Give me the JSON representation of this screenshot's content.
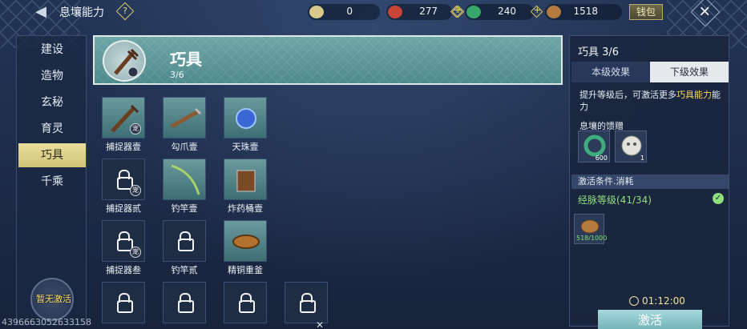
{
  "header_bar": {
    "title": "息壤能力",
    "help": "?",
    "resources": [
      {
        "icon": "gourd-icon",
        "value": "0",
        "color": "#d9c98a"
      },
      {
        "icon": "red-spiral-icon",
        "value": "277",
        "color": "#c84436"
      },
      {
        "icon": "green-coin-icon",
        "value": "240",
        "color": "#38a86a"
      },
      {
        "icon": "bean-icon",
        "value": "1518",
        "color": "#b47a3e"
      }
    ],
    "wallet_label": "钱包",
    "close_label": "✕"
  },
  "nav": {
    "items": [
      "建设",
      "造物",
      "玄秘",
      "育灵",
      "巧具",
      "千乘"
    ],
    "active_index": 4,
    "no_activate_label": "暂无激活"
  },
  "main": {
    "header": {
      "title": "巧具",
      "progress": "3/6"
    },
    "items": [
      {
        "label": "捕捉器壹",
        "unlocked": true,
        "badge": "宠"
      },
      {
        "label": "勾爪壹",
        "unlocked": true,
        "badge": ""
      },
      {
        "label": "天珠壹",
        "unlocked": true,
        "badge": ""
      },
      {
        "label": "捕捉器贰",
        "unlocked": false,
        "badge": "宠"
      },
      {
        "label": "钓竿壹",
        "unlocked": true,
        "badge": ""
      },
      {
        "label": "炸药桶壹",
        "unlocked": true,
        "badge": ""
      },
      {
        "label": "捕捉器叁",
        "unlocked": false,
        "badge": "宠"
      },
      {
        "label": "钓竿贰",
        "unlocked": false,
        "badge": ""
      },
      {
        "label": "精铜重釜",
        "unlocked": true,
        "badge": ""
      },
      {
        "label": "",
        "unlocked": false,
        "badge": ""
      },
      {
        "label": "",
        "unlocked": false,
        "badge": ""
      },
      {
        "label": "",
        "unlocked": false,
        "badge": ""
      },
      {
        "label": "",
        "unlocked": false,
        "badge": ""
      }
    ]
  },
  "panel": {
    "title": "巧具 3/6",
    "tabs": [
      "本级效果",
      "下级效果"
    ],
    "active_tab": 1,
    "desc_prefix": "提升等级后，可激活更多",
    "desc_highlight": "巧具能力",
    "desc_suffix": "能力",
    "gift_title": "息壤的馈赠",
    "gifts": [
      {
        "icon": "green-ring-icon",
        "count": "600"
      },
      {
        "icon": "white-mask-icon",
        "count": "1"
      }
    ],
    "condition_title": "激活条件.消耗",
    "condition_text": "经脉等级(41/34)",
    "cost": {
      "icon": "bean-icon",
      "count": "518/1000"
    },
    "timer": "01:12:00",
    "activate_label": "激活"
  },
  "footer": {
    "uid": "4396663052633158",
    "close_mark": "✕"
  }
}
